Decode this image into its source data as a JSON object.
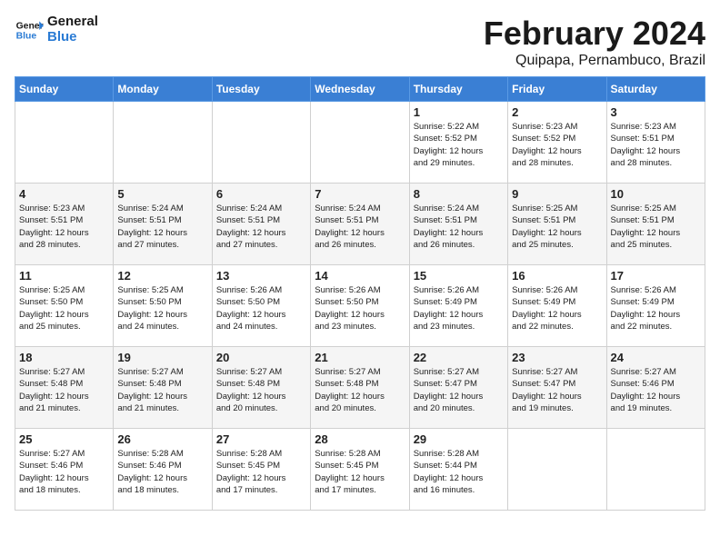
{
  "logo": {
    "text_general": "General",
    "text_blue": "Blue"
  },
  "header": {
    "month_year": "February 2024",
    "location": "Quipapa, Pernambuco, Brazil"
  },
  "weekdays": [
    "Sunday",
    "Monday",
    "Tuesday",
    "Wednesday",
    "Thursday",
    "Friday",
    "Saturday"
  ],
  "weeks": [
    [
      {
        "day": "",
        "info": ""
      },
      {
        "day": "",
        "info": ""
      },
      {
        "day": "",
        "info": ""
      },
      {
        "day": "",
        "info": ""
      },
      {
        "day": "1",
        "info": "Sunrise: 5:22 AM\nSunset: 5:52 PM\nDaylight: 12 hours\nand 29 minutes."
      },
      {
        "day": "2",
        "info": "Sunrise: 5:23 AM\nSunset: 5:52 PM\nDaylight: 12 hours\nand 28 minutes."
      },
      {
        "day": "3",
        "info": "Sunrise: 5:23 AM\nSunset: 5:51 PM\nDaylight: 12 hours\nand 28 minutes."
      }
    ],
    [
      {
        "day": "4",
        "info": "Sunrise: 5:23 AM\nSunset: 5:51 PM\nDaylight: 12 hours\nand 28 minutes."
      },
      {
        "day": "5",
        "info": "Sunrise: 5:24 AM\nSunset: 5:51 PM\nDaylight: 12 hours\nand 27 minutes."
      },
      {
        "day": "6",
        "info": "Sunrise: 5:24 AM\nSunset: 5:51 PM\nDaylight: 12 hours\nand 27 minutes."
      },
      {
        "day": "7",
        "info": "Sunrise: 5:24 AM\nSunset: 5:51 PM\nDaylight: 12 hours\nand 26 minutes."
      },
      {
        "day": "8",
        "info": "Sunrise: 5:24 AM\nSunset: 5:51 PM\nDaylight: 12 hours\nand 26 minutes."
      },
      {
        "day": "9",
        "info": "Sunrise: 5:25 AM\nSunset: 5:51 PM\nDaylight: 12 hours\nand 25 minutes."
      },
      {
        "day": "10",
        "info": "Sunrise: 5:25 AM\nSunset: 5:51 PM\nDaylight: 12 hours\nand 25 minutes."
      }
    ],
    [
      {
        "day": "11",
        "info": "Sunrise: 5:25 AM\nSunset: 5:50 PM\nDaylight: 12 hours\nand 25 minutes."
      },
      {
        "day": "12",
        "info": "Sunrise: 5:25 AM\nSunset: 5:50 PM\nDaylight: 12 hours\nand 24 minutes."
      },
      {
        "day": "13",
        "info": "Sunrise: 5:26 AM\nSunset: 5:50 PM\nDaylight: 12 hours\nand 24 minutes."
      },
      {
        "day": "14",
        "info": "Sunrise: 5:26 AM\nSunset: 5:50 PM\nDaylight: 12 hours\nand 23 minutes."
      },
      {
        "day": "15",
        "info": "Sunrise: 5:26 AM\nSunset: 5:49 PM\nDaylight: 12 hours\nand 23 minutes."
      },
      {
        "day": "16",
        "info": "Sunrise: 5:26 AM\nSunset: 5:49 PM\nDaylight: 12 hours\nand 22 minutes."
      },
      {
        "day": "17",
        "info": "Sunrise: 5:26 AM\nSunset: 5:49 PM\nDaylight: 12 hours\nand 22 minutes."
      }
    ],
    [
      {
        "day": "18",
        "info": "Sunrise: 5:27 AM\nSunset: 5:48 PM\nDaylight: 12 hours\nand 21 minutes."
      },
      {
        "day": "19",
        "info": "Sunrise: 5:27 AM\nSunset: 5:48 PM\nDaylight: 12 hours\nand 21 minutes."
      },
      {
        "day": "20",
        "info": "Sunrise: 5:27 AM\nSunset: 5:48 PM\nDaylight: 12 hours\nand 20 minutes."
      },
      {
        "day": "21",
        "info": "Sunrise: 5:27 AM\nSunset: 5:48 PM\nDaylight: 12 hours\nand 20 minutes."
      },
      {
        "day": "22",
        "info": "Sunrise: 5:27 AM\nSunset: 5:47 PM\nDaylight: 12 hours\nand 20 minutes."
      },
      {
        "day": "23",
        "info": "Sunrise: 5:27 AM\nSunset: 5:47 PM\nDaylight: 12 hours\nand 19 minutes."
      },
      {
        "day": "24",
        "info": "Sunrise: 5:27 AM\nSunset: 5:46 PM\nDaylight: 12 hours\nand 19 minutes."
      }
    ],
    [
      {
        "day": "25",
        "info": "Sunrise: 5:27 AM\nSunset: 5:46 PM\nDaylight: 12 hours\nand 18 minutes."
      },
      {
        "day": "26",
        "info": "Sunrise: 5:28 AM\nSunset: 5:46 PM\nDaylight: 12 hours\nand 18 minutes."
      },
      {
        "day": "27",
        "info": "Sunrise: 5:28 AM\nSunset: 5:45 PM\nDaylight: 12 hours\nand 17 minutes."
      },
      {
        "day": "28",
        "info": "Sunrise: 5:28 AM\nSunset: 5:45 PM\nDaylight: 12 hours\nand 17 minutes."
      },
      {
        "day": "29",
        "info": "Sunrise: 5:28 AM\nSunset: 5:44 PM\nDaylight: 12 hours\nand 16 minutes."
      },
      {
        "day": "",
        "info": ""
      },
      {
        "day": "",
        "info": ""
      }
    ]
  ]
}
